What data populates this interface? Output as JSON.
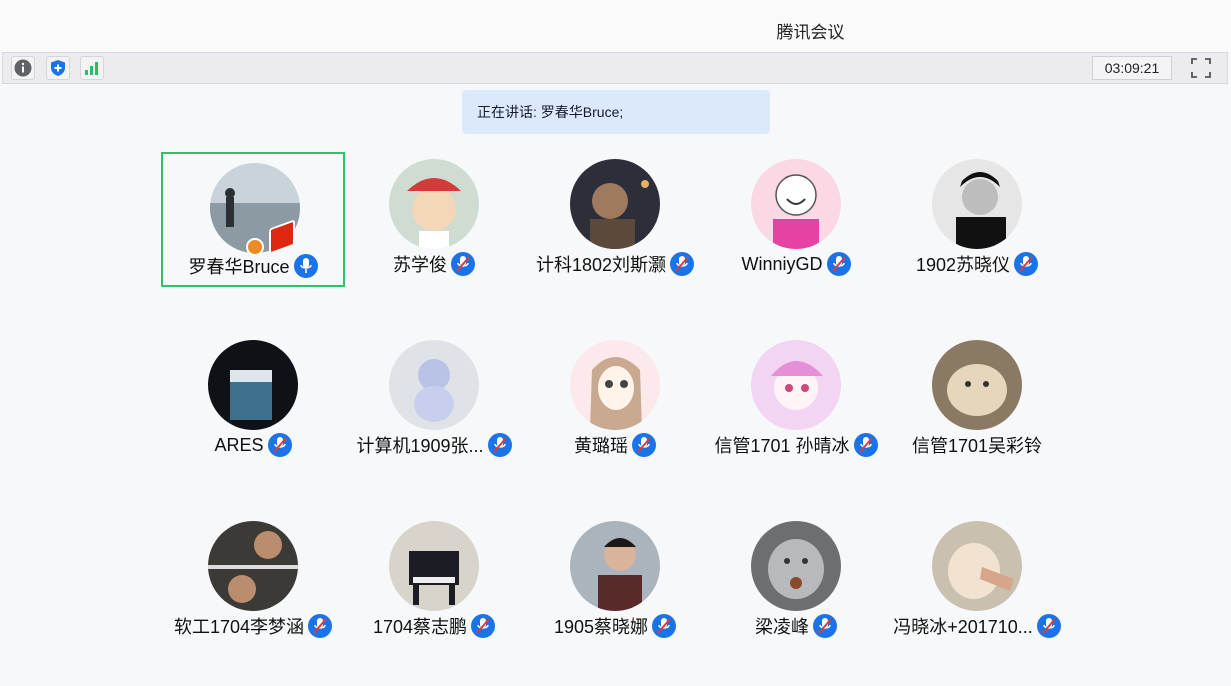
{
  "app": {
    "title": "腾讯会议"
  },
  "toolbar": {
    "timer": "03:09:21",
    "icons": [
      "info-icon",
      "shield-icon",
      "signal-icon",
      "fullscreen-icon"
    ]
  },
  "speaking": {
    "text": "正在讲话: 罗春华Bruce;"
  },
  "participants": [
    {
      "name": "罗春华Bruce",
      "active": true,
      "host": true
    },
    {
      "name": "苏学俊"
    },
    {
      "name": "计科1802刘斯灏"
    },
    {
      "name": "WinniyGD"
    },
    {
      "name": "1902苏晓仪"
    },
    {
      "name": "ARES"
    },
    {
      "name": "计算机1909张..."
    },
    {
      "name": "黄璐瑶"
    },
    {
      "name": "信管1701 孙晴冰"
    },
    {
      "name": "信管1701吴彩铃"
    },
    {
      "name": "软工1704李梦涵"
    },
    {
      "name": "1704蔡志鹏"
    },
    {
      "name": "1905蔡晓娜"
    },
    {
      "name": "梁凌峰"
    },
    {
      "name": "冯晓冰+201710..."
    }
  ],
  "colors": {
    "active_border": "#2cc36b",
    "mic_blue": "#1a73e8",
    "speaker_bg": "#dbe9fb"
  }
}
